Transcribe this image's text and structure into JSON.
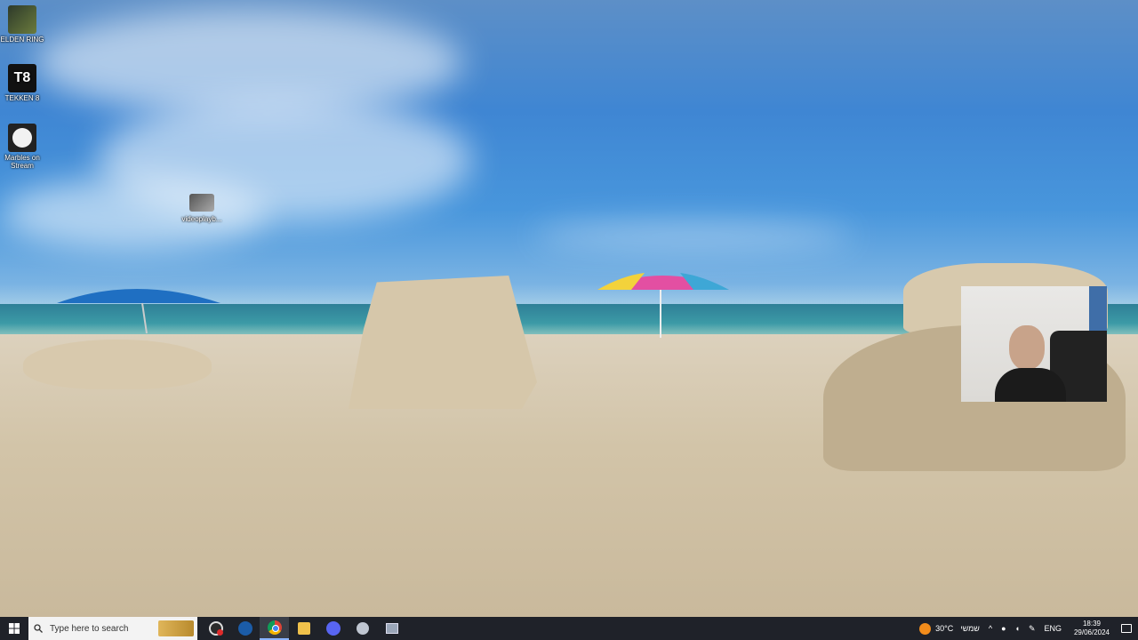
{
  "desktop": {
    "icons": [
      {
        "label": "ELDEN RING",
        "icon": "elden-ring-icon"
      },
      {
        "label": "TEKKEN 8",
        "icon": "tekken-icon"
      },
      {
        "label": "Marbles on Stream",
        "icon": "marbles-icon"
      },
      {
        "label": "videoplayb...",
        "icon": "video-file-icon"
      }
    ]
  },
  "taskbar": {
    "search_placeholder": "Type here to search",
    "apps": [
      "obs-icon",
      "steam-icon",
      "chrome-icon",
      "file-explorer-icon",
      "discord-icon",
      "app-icon",
      "window-icon"
    ],
    "weather": {
      "temp": "30°C",
      "label": "שמשי"
    },
    "language": "ENG",
    "time": "18:39",
    "date": "29/06/2024"
  },
  "colors": {
    "taskbar": "#1f2229",
    "accent": "#8ab4ff"
  }
}
